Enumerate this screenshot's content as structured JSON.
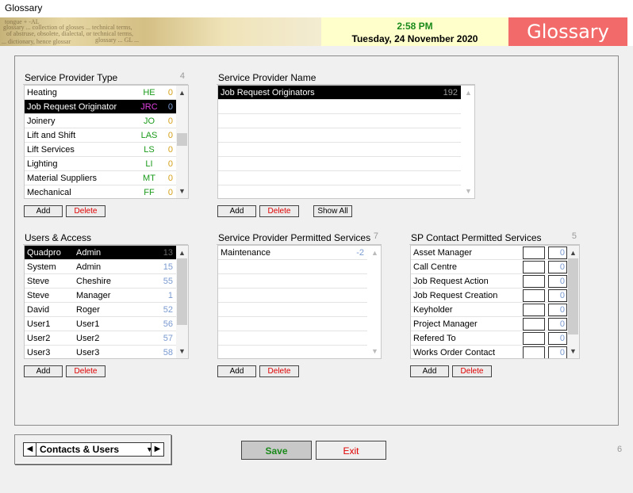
{
  "window": {
    "title": "Glossary"
  },
  "banner": {
    "time": "2:58 PM",
    "date": "Tuesday, 24 November 2020",
    "brand": "Glossary",
    "bg_text": [
      "tongue + -AL",
      "glossary ... collection of glosses ... technical terms,",
      "of abstruse, obsolete, dialectal, or technical terms,",
      "glossary  ... GL ... ",
      "... dictionary, hence glossar"
    ]
  },
  "service_provider_type": {
    "title": "Service Provider Type",
    "count": "4",
    "rows": [
      {
        "name": "Heating",
        "code": "HE",
        "num": "0",
        "code_color": "#1a9a1a"
      },
      {
        "name": "Job Request Originator",
        "code": "JRC",
        "num": "0",
        "code_color": "#e040e0",
        "selected": true
      },
      {
        "name": "Joinery",
        "code": "JO",
        "num": "0",
        "code_color": "#1a9a1a"
      },
      {
        "name": "Lift and Shift",
        "code": "LAS",
        "num": "0",
        "code_color": "#1a9a1a"
      },
      {
        "name": "Lift Services",
        "code": "LS",
        "num": "0",
        "code_color": "#1a9a1a"
      },
      {
        "name": "Lighting",
        "code": "LI",
        "num": "0",
        "code_color": "#1a9a1a"
      },
      {
        "name": "Material Suppliers",
        "code": "MT",
        "num": "0",
        "code_color": "#1a9a1a"
      },
      {
        "name": "Mechanical",
        "code": "FF",
        "num": "0",
        "code_color": "#1a9a1a"
      }
    ],
    "add_label": "Add",
    "delete_label": "Delete"
  },
  "service_provider_name": {
    "title": "Service Provider Name",
    "rows": [
      {
        "name": "Job Request Originators",
        "num": "192",
        "selected": true
      }
    ],
    "add_label": "Add",
    "delete_label": "Delete",
    "show_all_label": "Show All"
  },
  "users_access": {
    "title": "Users & Access",
    "rows": [
      {
        "first": "Quadpro",
        "last": "Admin",
        "num": "13",
        "selected": true
      },
      {
        "first": "System",
        "last": "Admin",
        "num": "15"
      },
      {
        "first": "Steve",
        "last": "Cheshire",
        "num": "55"
      },
      {
        "first": "Steve",
        "last": "Manager",
        "num": "1"
      },
      {
        "first": "David",
        "last": "Roger",
        "num": "52"
      },
      {
        "first": "User1",
        "last": "User1",
        "num": "56"
      },
      {
        "first": "User2",
        "last": "User2",
        "num": "57"
      },
      {
        "first": "User3",
        "last": "User3",
        "num": "58"
      }
    ],
    "add_label": "Add",
    "delete_label": "Delete"
  },
  "sp_permitted_services": {
    "title": "Service Provider Permitted Services",
    "count": "7",
    "rows": [
      {
        "name": "Maintenance",
        "num": "-2"
      }
    ],
    "add_label": "Add",
    "delete_label": "Delete"
  },
  "sp_contact_permitted_services": {
    "title": "SP Contact Permitted Services",
    "count": "5",
    "rows": [
      {
        "name": "Asset Manager",
        "num": "0"
      },
      {
        "name": "Call Centre",
        "num": "0"
      },
      {
        "name": "Job Request Action",
        "num": "0"
      },
      {
        "name": "Job Request Creation",
        "num": "0"
      },
      {
        "name": "Keyholder",
        "num": "0"
      },
      {
        "name": "Project Manager",
        "num": "0"
      },
      {
        "name": "Refered To",
        "num": "0"
      },
      {
        "name": "Works Order Contact",
        "num": "0"
      }
    ],
    "add_label": "Add",
    "delete_label": "Delete"
  },
  "footer": {
    "nav_value": "Contacts & Users",
    "save_label": "Save",
    "exit_label": "Exit",
    "page_number": "6"
  },
  "colors": {
    "brand": "#f26a6a",
    "clock_bg": "#ffffcc",
    "time": "#1a8a1a",
    "delete": "#e00000",
    "save": "#1a8a1a",
    "muted_number": "#7a9ad0",
    "gold_number": "#d4a017"
  }
}
